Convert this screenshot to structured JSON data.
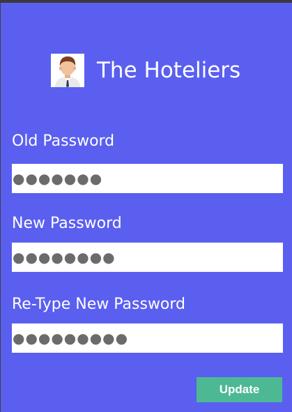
{
  "app": {
    "title": "The Hoteliers",
    "avatar_icon": "user-avatar-icon"
  },
  "form": {
    "old_password": {
      "label": "Old Password",
      "value": "●●●●●●●"
    },
    "new_password": {
      "label": "New Password",
      "value": "●●●●●●●●"
    },
    "retype_password": {
      "label": "Re-Type New Password",
      "value": "●●●●●●●●●"
    },
    "submit_label": "Update"
  },
  "colors": {
    "background": "#5a5ff0",
    "button": "#4db894",
    "text": "#ffffff",
    "mask_dots": "#6b6b6b"
  }
}
